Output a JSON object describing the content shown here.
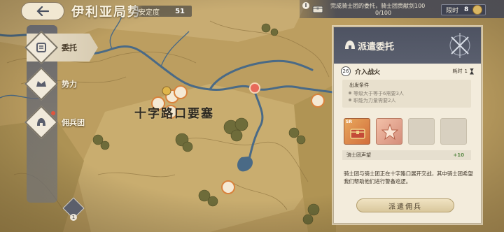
{
  "header": {
    "title": "伊利亚局势",
    "stability_label": "安定度",
    "stability_value": "51"
  },
  "nav": {
    "items": [
      {
        "label": "委托",
        "icon": "scroll-icon",
        "active": true
      },
      {
        "label": "势力",
        "icon": "crown-icon",
        "active": false
      },
      {
        "label": "佣兵团",
        "icon": "helmet-icon",
        "active": false
      }
    ],
    "bottom_badge": "1"
  },
  "quest_bar": {
    "text": "完成骑士团的委托，骑士团贡献剑100",
    "progress": "0/100",
    "limit_label": "限时",
    "limit_value": "8"
  },
  "map": {
    "place_label": "十字路口要塞"
  },
  "panel": {
    "title": "派遣委托",
    "mission_level": "26",
    "mission_name": "介入战火",
    "turn_label": "耗时",
    "turn_value": "1",
    "conditions_title": "出发条件",
    "conditions": [
      "等级大于等于6需要3人",
      "职能为力量需要2人"
    ],
    "slot_badge": "SR",
    "reward_label": "骑士团声望",
    "reward_value": "+10",
    "description": "骑士团与骑士团正在十字路口展开交战，其中骑士团希望我们帮助他们进行警备巡逻。",
    "dispatch_label": "派遣佣兵"
  },
  "colors": {
    "map_base": "#b89a5c",
    "river": "#4a6a86",
    "panel_bg": "#f3ecdc",
    "panel_header": "#4e5362",
    "reward_green": "#5c8a48"
  }
}
